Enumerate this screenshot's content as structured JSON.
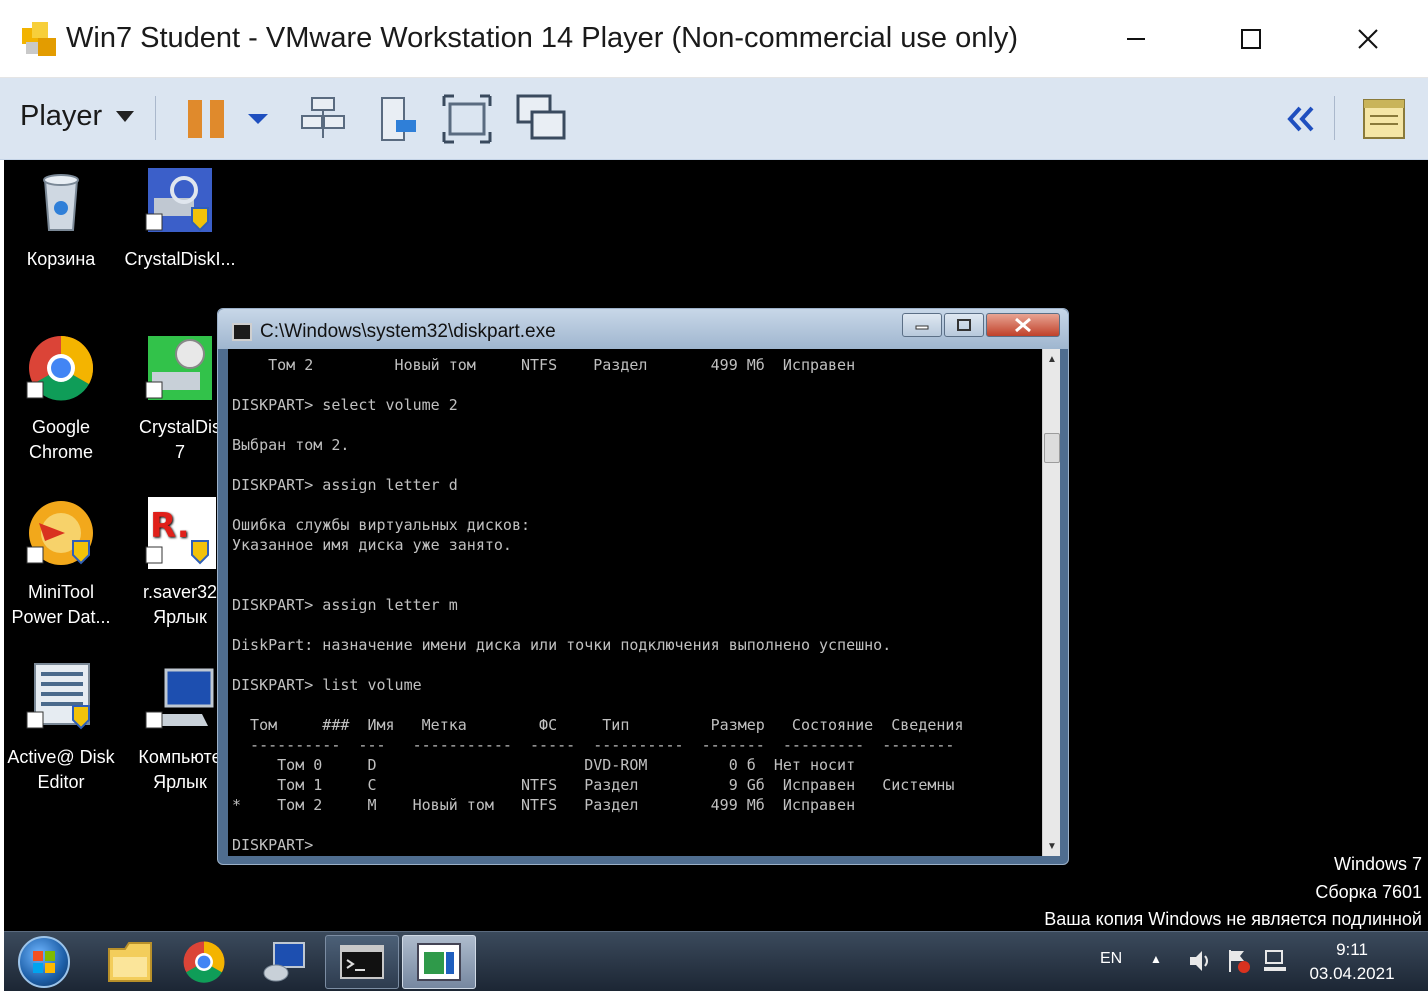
{
  "vmware": {
    "title": "Win7 Student - VMware Workstation 14 Player (Non-commercial use only)",
    "menu_player": "Player",
    "icons": [
      "vmware-logo-icon",
      "pause-icon",
      "dropdown-arrow-icon",
      "network-devices-icon",
      "removable-device-icon",
      "fullscreen-icon",
      "unity-icon",
      "collapse-double-chevron-icon",
      "notes-icon"
    ]
  },
  "desktop": {
    "icons": [
      {
        "label1": "Корзина",
        "label2": ""
      },
      {
        "label1": "CrystalDiskI...",
        "label2": ""
      },
      {
        "label1": "Google",
        "label2": "Chrome"
      },
      {
        "label1": "CrystalDis",
        "label2": "7"
      },
      {
        "label1": "MiniTool",
        "label2": "Power Dat..."
      },
      {
        "label1": "r.saver32",
        "label2": "Ярлык"
      },
      {
        "label1": "Active@ Disk",
        "label2": "Editor"
      },
      {
        "label1": "Компьюте",
        "label2": "Ярлык"
      }
    ],
    "watermark": {
      "line1": "Windows 7",
      "line2": "Сборка 7601",
      "line3": "Ваша копия Windows не является подлинной"
    }
  },
  "console": {
    "title": "C:\\Windows\\system32\\diskpart.exe",
    "lines": [
      "    Том 2         Новый том     NTFS    Раздел       499 Мб  Исправен",
      "",
      "DISKPART> select volume 2",
      "",
      "Выбран том 2.",
      "",
      "DISKPART> assign letter d",
      "",
      "Ошибка службы виртуальных дисков:",
      "Указанное имя диска уже занято.",
      "",
      "",
      "DISKPART> assign letter m",
      "",
      "DiskPart: назначение имени диска или точки подключения выполнено успешно.",
      "",
      "DISKPART> list volume",
      "",
      "  Том     ###  Имя   Метка        ФС     Тип         Размер   Состояние  Сведения",
      "  ----------  ---   -----------  -----  ----------  -------  ---------  --------",
      "     Том 0     D                       DVD-ROM         0 б  Нет носит",
      "     Том 1     C                NTFS   Раздел          9 Gб  Исправен   Системны",
      "*    Том 2     M    Новый том   NTFS   Раздел        499 Мб  Исправен",
      "",
      "DISKPART> "
    ]
  },
  "taskbar": {
    "lang": "EN",
    "time": "9:11",
    "date": "03.04.2021"
  }
}
